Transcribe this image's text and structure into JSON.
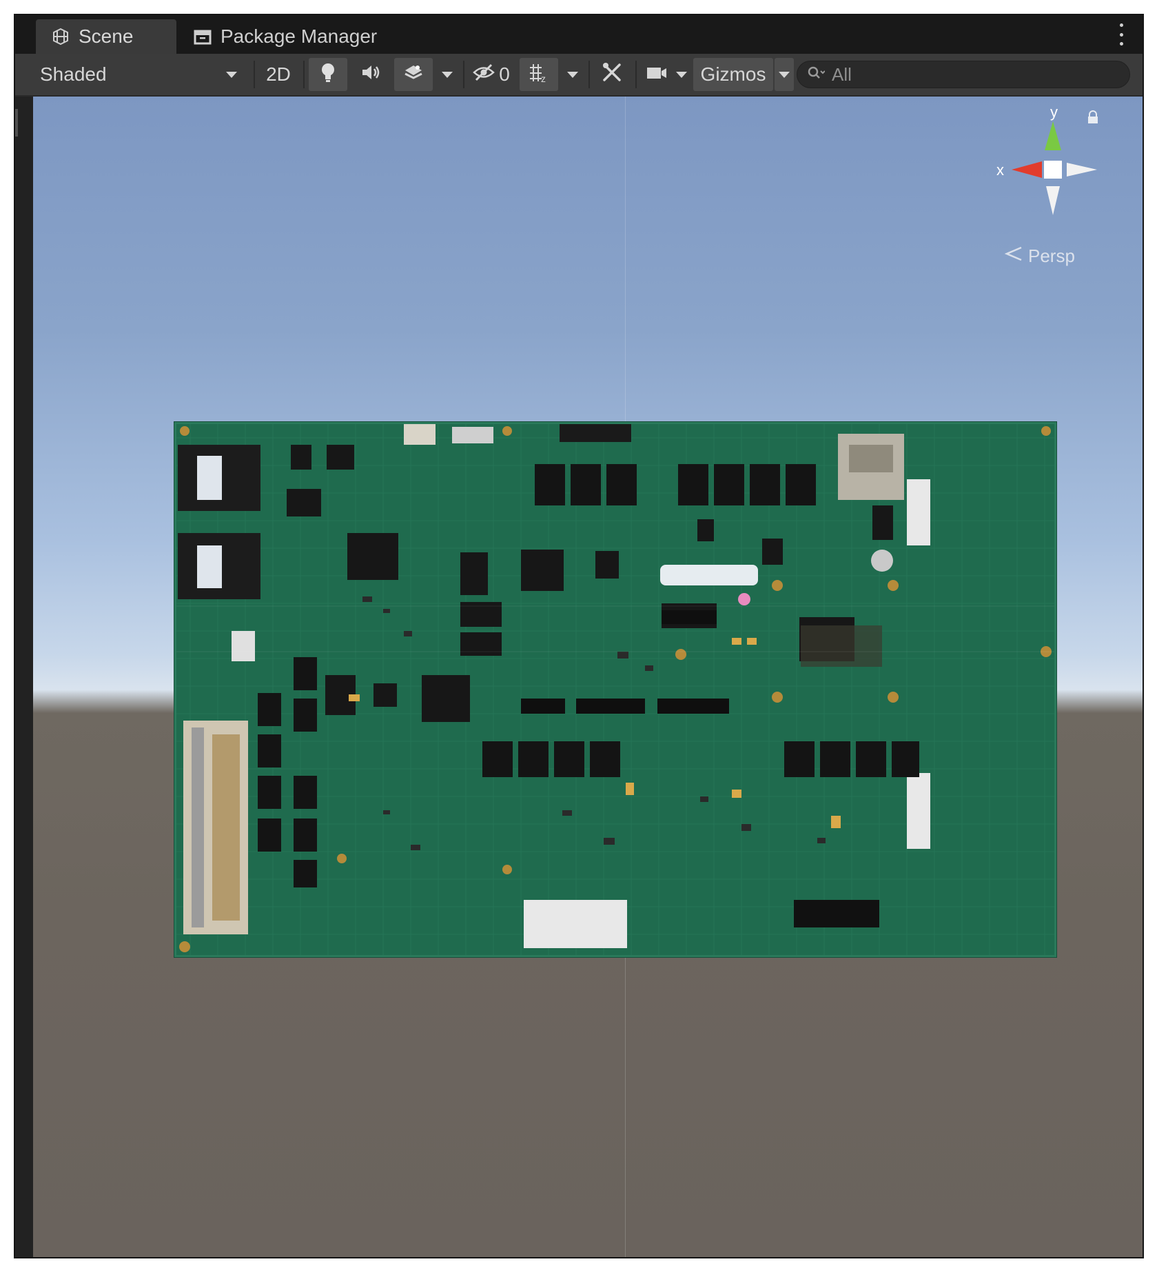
{
  "tabs": [
    {
      "label": "Scene",
      "icon": "scene-grid-icon",
      "active": true
    },
    {
      "label": "Package Manager",
      "icon": "package-icon",
      "active": false
    }
  ],
  "toolbar": {
    "draw_mode": "Shaded",
    "toggle_2d": "2D",
    "hidden_count": "0",
    "gizmos_label": "Gizmos",
    "search_placeholder": "All"
  },
  "viewport": {
    "axis_x_label": "x",
    "axis_y_label": "y",
    "projection_label": "Persp",
    "colors": {
      "axis_x": "#e23c2c",
      "axis_y": "#7ac943",
      "axis_z": "#ffffff",
      "sky": "#8aa4ca",
      "ground": "#6c655e"
    }
  },
  "scene_object": {
    "icon": "circuit-board-texture",
    "board_color": "#1f6b4e"
  }
}
